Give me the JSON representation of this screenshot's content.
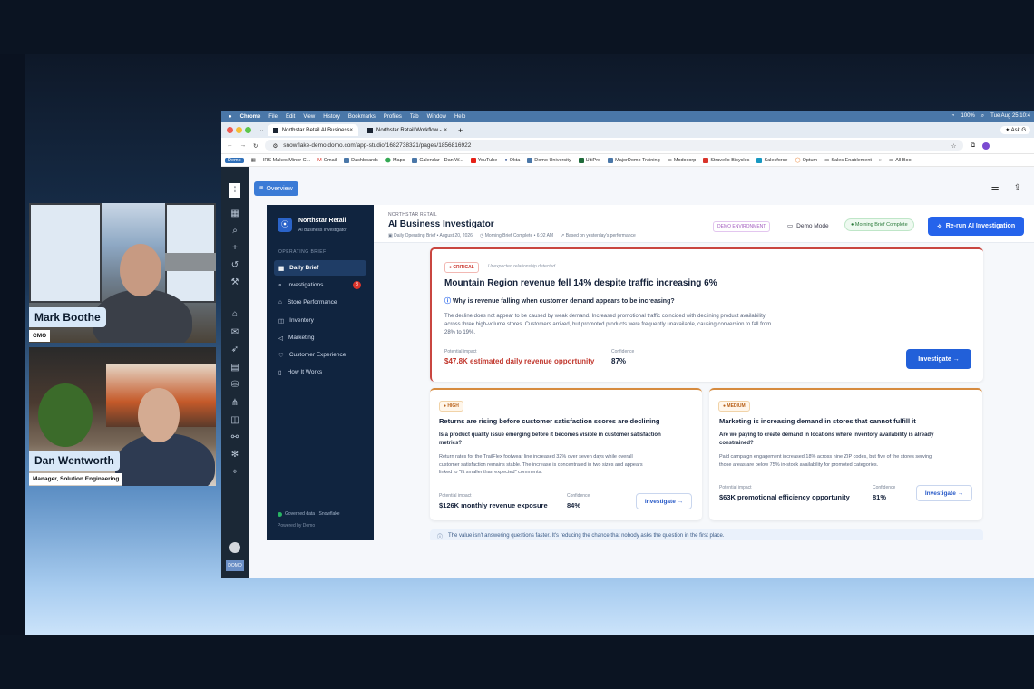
{
  "participants": [
    {
      "name": "Mark Boothe",
      "role": "CMO"
    },
    {
      "name": "Dan Wentworth",
      "role": "Manager, Solution Engineering"
    }
  ],
  "macos": {
    "app": "Chrome",
    "menus": [
      "File",
      "Edit",
      "View",
      "History",
      "Bookmarks",
      "Profiles",
      "Tab",
      "Window",
      "Help"
    ],
    "battery": "100%",
    "clock": "Tue Aug 25  10:4"
  },
  "browser": {
    "tabs": [
      "Northstar Retail AI Business",
      "Northstar Retail Workflow -"
    ],
    "new_tab": "+",
    "ask": "Ask G",
    "url": "snowflake-demo.domo.com/app-studio/1682738321/pages/1856816922",
    "bookmarks": [
      "Demo",
      "IRS Makes Minor C...",
      "Gmail",
      "Dashboards",
      "Maps",
      "Calendar - Dan W...",
      "YouTube",
      "Okta",
      "Domo University",
      "UltiPro",
      "MajorDomo Training",
      "Modocorp",
      "Stravello Bicycles",
      "Salesforce",
      "Optum",
      "Sales Enablement",
      "»",
      "All Boo"
    ]
  },
  "app": {
    "overview_button": "Overview",
    "brand": {
      "name": "Northstar Retail",
      "sub": "AI Business Investigator"
    },
    "nav_section": "OPERATING BRIEF",
    "nav": [
      {
        "label": "Daily Brief",
        "icon": "grid-icon",
        "active": true
      },
      {
        "label": "Investigations",
        "icon": "search-icon",
        "badge": "3"
      },
      {
        "label": "Store Performance",
        "icon": "store-icon"
      },
      {
        "label": "Inventory",
        "icon": "box-icon"
      },
      {
        "label": "Marketing",
        "icon": "megaphone-icon"
      },
      {
        "label": "Customer Experience",
        "icon": "heart-icon"
      },
      {
        "label": "How It Works",
        "icon": "book-icon"
      }
    ],
    "governed": "Governed data · Snowflake",
    "powered": "Powered by Domo",
    "header": {
      "eyebrow": "NORTHSTAR RETAIL",
      "title": "AI Business Investigator",
      "meta1": "Daily Operating Brief • August 20, 2026",
      "meta2": "Morning Brief Complete • 6:02 AM",
      "meta3": "Based on yesterday's performance",
      "demo_env": "DEMO ENVIRONMENT",
      "demo_mode": "Demo Mode",
      "brief_pill": "Morning Brief Complete",
      "rerun": "Re-run AI Investigation"
    },
    "critical": {
      "badge": "● CRITICAL",
      "note": "Unexpected relationship detected",
      "title": "Mountain Region revenue fell 14% despite traffic increasing 6%",
      "question": "Why is revenue falling when customer demand appears to be increasing?",
      "body1": "The decline does not appear to be caused by weak demand. Increased promotional traffic coincided with declining product availability",
      "body2": "across three high-volume stores. Customers arrived, but promoted products were frequently unavailable, causing conversion to fall from",
      "body3": "28% to 19%.",
      "impact_label": "Potential impact",
      "impact_value": "$47.8K estimated daily revenue opportunity",
      "conf_label": "Confidence",
      "conf_value": "87%",
      "button": "Investigate →"
    },
    "high": {
      "badge": "● HIGH",
      "title": "Returns are rising before customer satisfaction scores are declining",
      "question1": "Is a product quality issue emerging before it becomes visible in customer satisfaction",
      "question2": "metrics?",
      "body1": "Return rates for the TrailFlex footwear line increased 32% over seven days while overall",
      "body2": "customer satisfaction remains stable. The increase is concentrated in two sizes and appears",
      "body3": "linked to \"fit smaller than expected\" comments.",
      "impact_label": "Potential impact",
      "impact_value": "$126K monthly revenue exposure",
      "conf_label": "Confidence",
      "conf_value": "84%",
      "button": "Investigate →"
    },
    "medium": {
      "badge": "● MEDIUM",
      "title": "Marketing is increasing demand in stores that cannot fulfill it",
      "question1": "Are we paying to create demand in locations where inventory availability is already",
      "question2": "constrained?",
      "body1": "Paid campaign engagement increased 18% across nine ZIP codes, but five of the stores serving",
      "body2": "those areas are below 75% in-stock availability for promoted categories.",
      "impact_label": "Potential impact",
      "impact_value": "$63K promotional efficiency opportunity",
      "conf_label": "Confidence",
      "conf_value": "81%",
      "button": "Investigate →"
    },
    "footer_note": "The value isn't answering questions faster. It's reducing the chance that nobody asks the question in the first place.",
    "dock_label": "DOMO"
  },
  "colors": {
    "accent": "#2563eb",
    "critical": "#c94640",
    "warning": "#d68b3f",
    "nav_bg": "#10243f"
  }
}
